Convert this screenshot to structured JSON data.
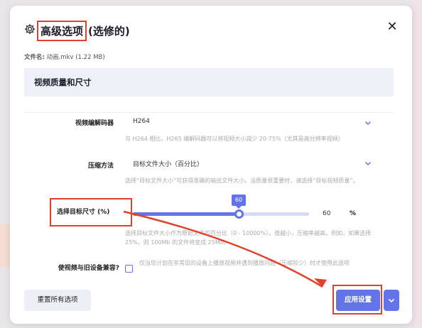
{
  "dialog": {
    "title_main": "高级选项",
    "title_sub": "(选修的)",
    "close_symbol": "✕",
    "filename_label": "文件名:",
    "filename_value": "动画.mkv (1.22 MB)"
  },
  "section": {
    "title": "视频质量和尺寸"
  },
  "codec": {
    "label": "视频编解码器",
    "value": "H264",
    "hint": "与 H264 相比，H265 编解码器可以将视频大小减少 20-75%（尤其是高分辨率视频）"
  },
  "compression": {
    "label": "压缩方法",
    "value": "目标文件大小（百分比）",
    "hint": "选择“目标文件大小”可获得准确的输出文件大小。当质量很重要时，请选择“目标视频质量”。"
  },
  "target": {
    "label": "选择目标尺寸 (%)",
    "value": "60",
    "tooltip": "60",
    "unit": "%",
    "level_percent": 60,
    "hint": "选择目标文件大小作为原始文件的百分比（0 - 10000%）。值越小，压缩率越高。例如，如果选择 25%，则 100Mb 的文件将变成 25Mb。"
  },
  "compat": {
    "label": "使视频与旧设备兼容?",
    "hint": "仅当您计划在非常旧的设备上播放视频并遇到播放问题（压缩较少）时才使用此选项",
    "checked": false
  },
  "footer": {
    "reset_label": "重置所有选项",
    "apply_label": "应用设置"
  },
  "colors": {
    "accent": "#6375e6",
    "highlight": "#e0412b"
  }
}
